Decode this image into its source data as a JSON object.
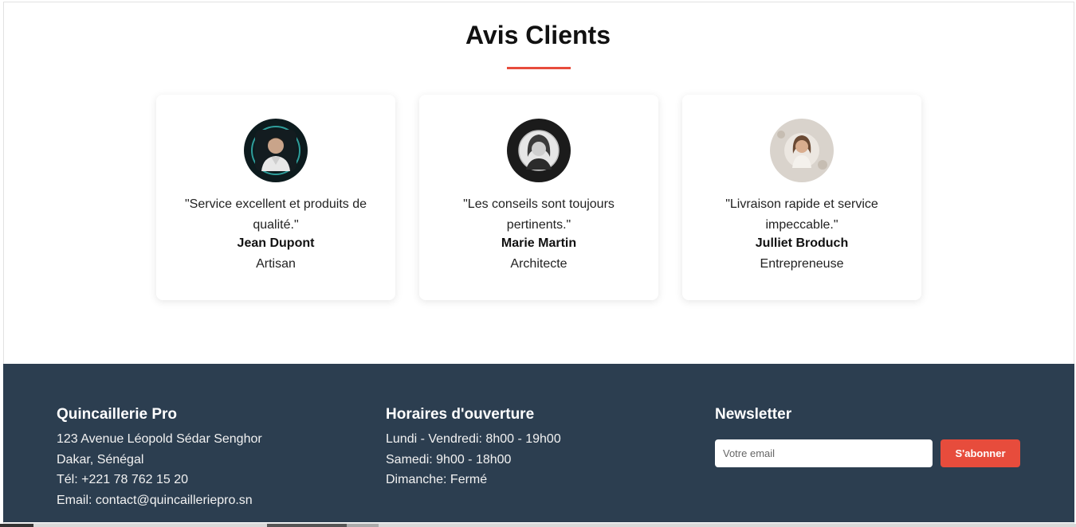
{
  "testimonials": {
    "title": "Avis Clients",
    "accent_color": "#e74c3c",
    "items": [
      {
        "quote": "\"Service excellent et produits de qualité.\"",
        "name": "Jean Dupont",
        "role": "Artisan",
        "avatar_icon": "man-portrait"
      },
      {
        "quote": "\"Les conseils sont toujours pertinents.\"",
        "name": "Marie Martin",
        "role": "Architecte",
        "avatar_icon": "woman-portrait-bw"
      },
      {
        "quote": "\"Livraison rapide et service impeccable.\"",
        "name": "Julliet Broduch",
        "role": "Entrepreneuse",
        "avatar_icon": "woman-portrait"
      }
    ]
  },
  "footer": {
    "background": "#2c3e50",
    "company": {
      "title": "Quincaillerie Pro",
      "address": "123 Avenue Léopold Sédar Senghor",
      "city": "Dakar, Sénégal",
      "phone": "Tél: +221 78 762 15 20",
      "email": "Email: contact@quincailleriepro.sn"
    },
    "hours": {
      "title": "Horaires d'ouverture",
      "weekdays": "Lundi - Vendredi: 8h00 - 19h00",
      "saturday": "Samedi: 9h00 - 18h00",
      "sunday": "Dimanche: Fermé"
    },
    "newsletter": {
      "title": "Newsletter",
      "placeholder": "Votre email",
      "button_label": "S'abonner",
      "button_color": "#e74c3c"
    }
  }
}
